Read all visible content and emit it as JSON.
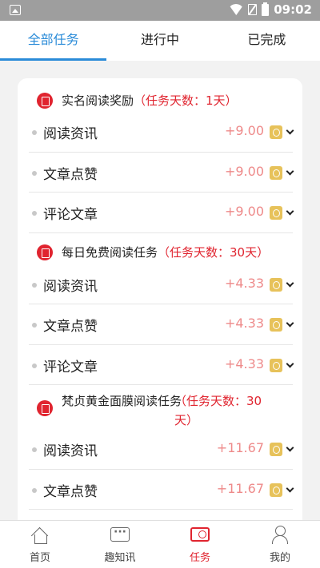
{
  "status_bar": {
    "time": "09:02"
  },
  "tabs": [
    {
      "label": "全部任务"
    },
    {
      "label": "进行中"
    },
    {
      "label": "已完成"
    }
  ],
  "groups": [
    {
      "title": "实名阅读奖励",
      "days": "（任务天数：1天）",
      "items": [
        {
          "label": "阅读资讯",
          "value": "+9.00"
        },
        {
          "label": "文章点赞",
          "value": "+9.00"
        },
        {
          "label": "评论文章",
          "value": "+9.00"
        }
      ]
    },
    {
      "title": "每日免费阅读任务",
      "days": "（任务天数：30天）",
      "items": [
        {
          "label": "阅读资讯",
          "value": "+4.33"
        },
        {
          "label": "文章点赞",
          "value": "+4.33"
        },
        {
          "label": "评论文章",
          "value": "+4.33"
        }
      ]
    },
    {
      "title": "梵贞黄金面膜阅读任务",
      "days": "（任务天数：30天）",
      "items": [
        {
          "label": "阅读资讯",
          "value": "+11.67"
        },
        {
          "label": "文章点赞",
          "value": "+11.67"
        }
      ]
    }
  ],
  "bottom_nav": [
    {
      "label": "首页",
      "icon": "home-icon"
    },
    {
      "label": "趣知讯",
      "icon": "chat-icon"
    },
    {
      "label": "任务",
      "icon": "task-icon"
    },
    {
      "label": "我的",
      "icon": "user-icon"
    }
  ],
  "colors": {
    "accent_blue": "#2a8bd8",
    "accent_red": "#e0242f",
    "reward": "#ee8a8a"
  }
}
